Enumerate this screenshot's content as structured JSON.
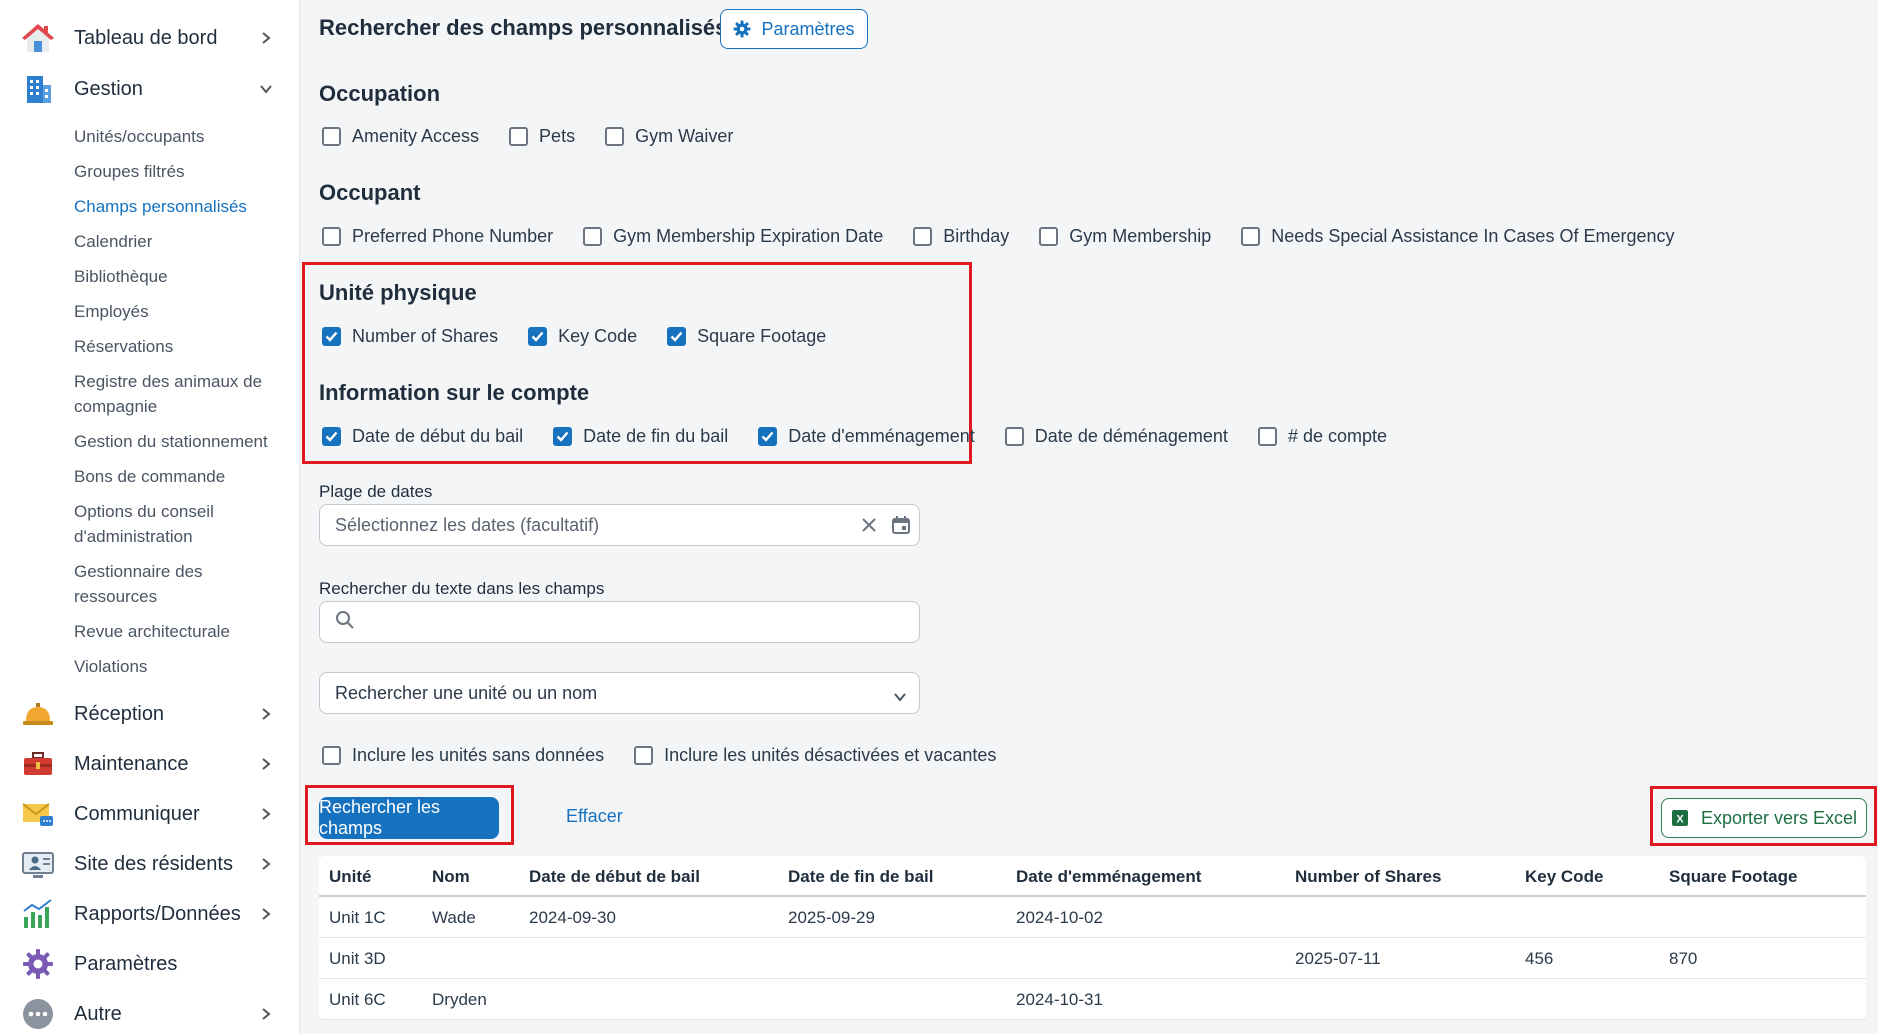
{
  "sidebar": {
    "dashboard": "Tableau de bord",
    "management": "Gestion",
    "sub_items": [
      "Unités/occupants",
      "Groupes filtrés",
      "Champs personnalisés",
      "Calendrier",
      "Bibliothèque",
      "Employés",
      "Réservations",
      "Registre des animaux de compagnie",
      "Gestion du stationnement",
      "Bons de commande",
      "Options du conseil d'administration",
      "Gestionnaire des ressources",
      "Revue architecturale",
      "Violations"
    ],
    "reception": "Réception",
    "maintenance": "Maintenance",
    "communicate": "Communiquer",
    "residents_site": "Site des résidents",
    "reports": "Rapports/Données",
    "settings": "Paramètres",
    "other": "Autre"
  },
  "header": {
    "title": "Rechercher des champs personnalisés",
    "settings_button": "Paramètres"
  },
  "sections": {
    "occupation": {
      "title": "Occupation",
      "options": [
        {
          "label": "Amenity Access",
          "checked": false
        },
        {
          "label": "Pets",
          "checked": false
        },
        {
          "label": "Gym Waiver",
          "checked": false
        }
      ]
    },
    "occupant": {
      "title": "Occupant",
      "options": [
        {
          "label": "Preferred Phone Number",
          "checked": false
        },
        {
          "label": "Gym Membership Expiration Date",
          "checked": false
        },
        {
          "label": "Birthday",
          "checked": false
        },
        {
          "label": "Gym Membership",
          "checked": false
        },
        {
          "label": "Needs Special Assistance In Cases Of Emergency",
          "checked": false
        }
      ]
    },
    "physical_unit": {
      "title": "Unité physique",
      "options": [
        {
          "label": "Number of Shares",
          "checked": true
        },
        {
          "label": "Key Code",
          "checked": true
        },
        {
          "label": "Square Footage",
          "checked": true
        }
      ]
    },
    "account_info": {
      "title": "Information sur le compte",
      "options": [
        {
          "label": "Date de début du bail",
          "checked": true
        },
        {
          "label": "Date de fin du bail",
          "checked": true
        },
        {
          "label": "Date d'emménagement",
          "checked": true
        },
        {
          "label": "Date de déménagement",
          "checked": false
        },
        {
          "label": "# de compte",
          "checked": false
        }
      ]
    }
  },
  "filters": {
    "date_range_label": "Plage de dates",
    "date_range_placeholder": "Sélectionnez les dates (facultatif)",
    "text_search_label": "Rechercher du texte dans les champs",
    "text_search_value": "",
    "unit_search_placeholder": "Rechercher une unité ou un nom",
    "include_no_data": "Inclure les unités sans données",
    "include_disabled": "Inclure les unités désactivées et vacantes"
  },
  "actions": {
    "search_button": "Rechercher les champs",
    "clear_button": "Effacer",
    "export_button": "Exporter vers Excel"
  },
  "table": {
    "columns": [
      "Unité",
      "Nom",
      "Date de début de bail",
      "Date de fin de bail",
      "Date d'emménagement",
      "Number of Shares",
      "Key Code",
      "Square Footage"
    ],
    "rows": [
      [
        "Unit 1C",
        "Wade",
        "2024-09-30",
        "2025-09-29",
        "2024-10-02",
        "",
        "",
        ""
      ],
      [
        "Unit 3D",
        "",
        "",
        "",
        "",
        "2025-07-11",
        "456",
        "870"
      ],
      [
        "Unit 6C",
        "Dryden",
        "",
        "",
        "2024-10-31",
        "",
        "",
        ""
      ]
    ]
  },
  "colors": {
    "primary": "#1672bf",
    "highlight": "#e0191f",
    "excel_green": "#1d6f42"
  }
}
